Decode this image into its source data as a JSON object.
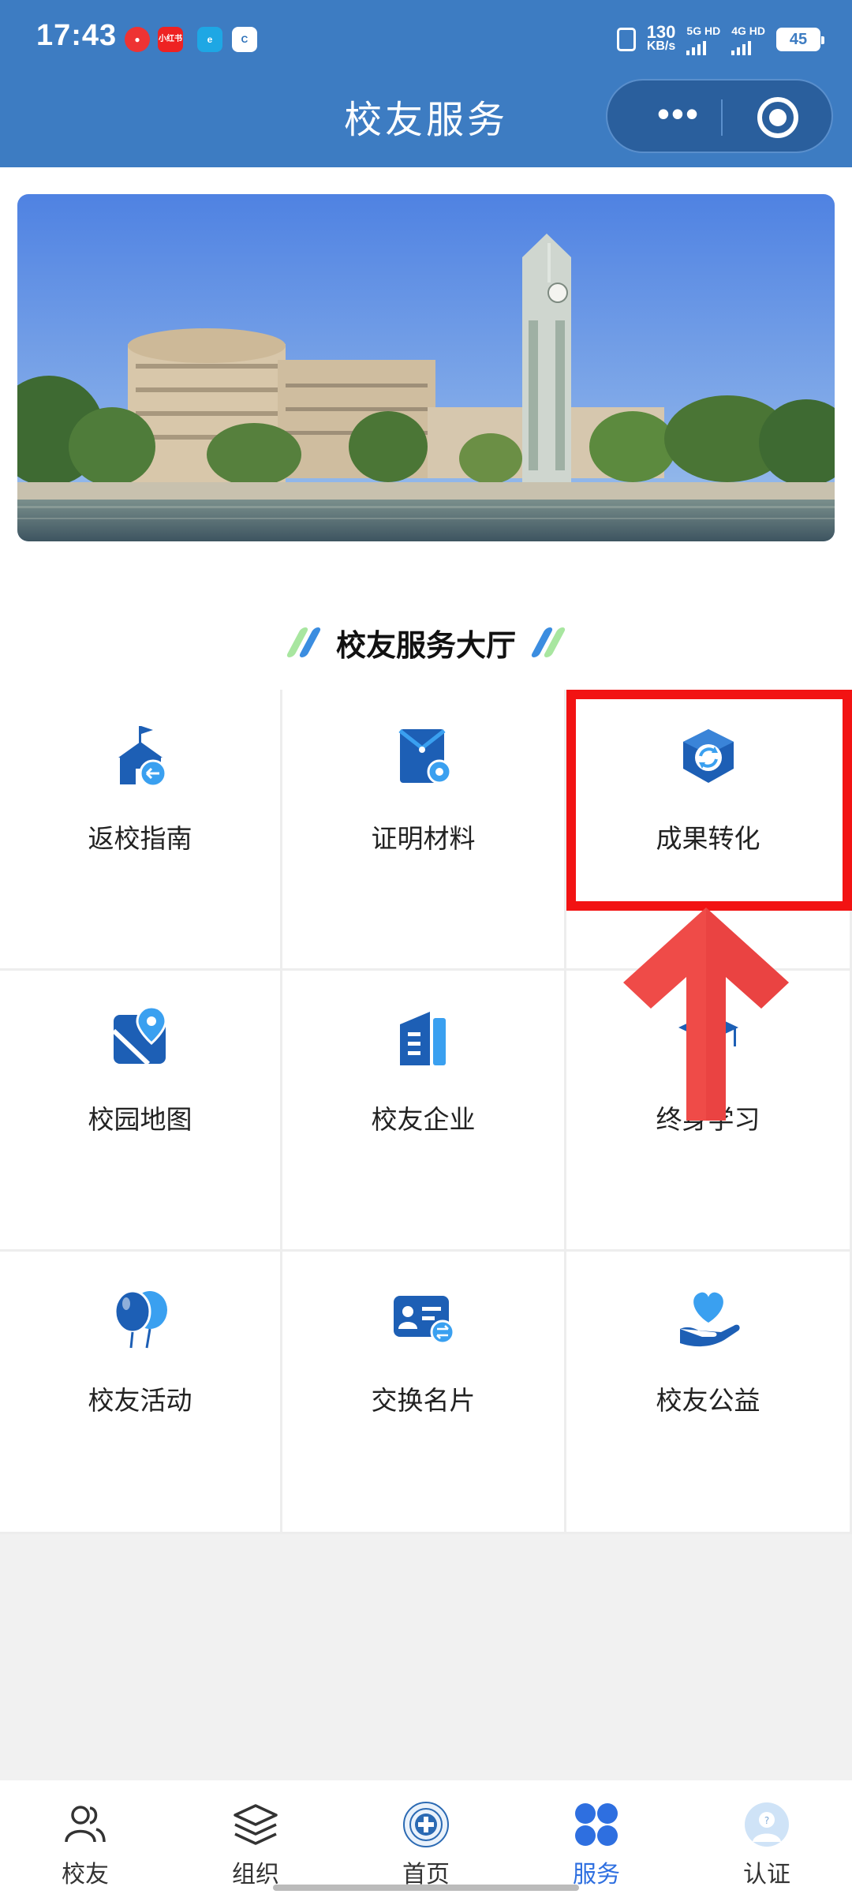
{
  "status_bar": {
    "time": "17:43",
    "speed_value": "130",
    "speed_unit": "KB/s",
    "sim1": "5G HD",
    "sim2": "4G HD",
    "battery": "45",
    "notification_icons": [
      "netease-music-icon",
      "xiaohongshu-icon",
      "e-icon",
      "c-icon"
    ],
    "notification_labels": [
      "",
      "小红书",
      "e",
      "C"
    ]
  },
  "header": {
    "title": "校友服务",
    "menu_label": "•••",
    "accent_color": "#3d7cc2"
  },
  "banner": {
    "icon": "campus-photo"
  },
  "section": {
    "title": "校友服务大厅"
  },
  "services": [
    {
      "label": "返校指南",
      "icon": "school-return-icon"
    },
    {
      "label": "证明材料",
      "icon": "document-settings-icon"
    },
    {
      "label": "成果转化",
      "icon": "cube-refresh-icon"
    },
    {
      "label": "校园地图",
      "icon": "map-pin-icon"
    },
    {
      "label": "校友企业",
      "icon": "building-icon"
    },
    {
      "label": "终身学习",
      "icon": "graduation-cap-icon"
    },
    {
      "label": "校友活动",
      "icon": "balloons-icon"
    },
    {
      "label": "交换名片",
      "icon": "business-card-icon"
    },
    {
      "label": "校友公益",
      "icon": "heart-hand-icon"
    }
  ],
  "annotation": {
    "highlight_color": "#f21313",
    "arrow_color": "#ef4b48"
  },
  "tabbar": {
    "active_color": "#2e6fe0",
    "tabs": [
      {
        "label": "校友",
        "icon": "people-icon"
      },
      {
        "label": "组织",
        "icon": "layers-icon"
      },
      {
        "label": "首页",
        "icon": "university-logo-icon"
      },
      {
        "label": "服务",
        "icon": "grid-icon"
      },
      {
        "label": "认证",
        "icon": "user-verify-icon"
      }
    ]
  }
}
